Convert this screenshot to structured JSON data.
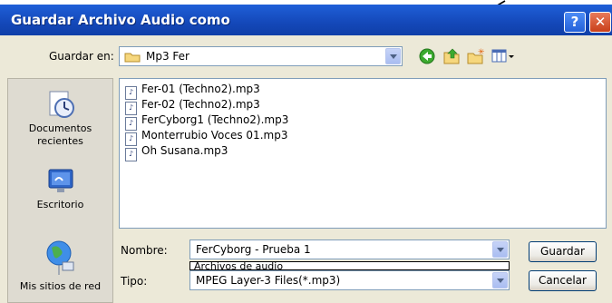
{
  "window": {
    "title": "Guardar Archivo Audio como",
    "help_label": "?",
    "close_label": "✕"
  },
  "location": {
    "label": "Guardar en:",
    "value": "Mp3 Fer"
  },
  "places": [
    {
      "label": "Documentos recientes",
      "icon": "recent-documents-icon"
    },
    {
      "label": "Escritorio",
      "icon": "desktop-icon"
    },
    {
      "label": "Mis sitios de red",
      "icon": "network-places-icon"
    }
  ],
  "files": [
    "Fer-01 (Techno2).mp3",
    "Fer-02 (Techno2).mp3",
    "FerCyborg1 (Techno2).mp3",
    "Monterrubio Voces 01.mp3",
    "Oh Susana.mp3"
  ],
  "filename": {
    "label": "Nombre:",
    "value": "FerCyborg - Prueba 1"
  },
  "filetype": {
    "label": "Tipo:",
    "value": "MPEG Layer-3 Files(*.mp3)",
    "dropdown_peek": "Archivos de audio"
  },
  "buttons": {
    "save": "Guardar",
    "cancel": "Cancelar"
  },
  "colors": {
    "titlebar": "#1448b9",
    "dialog_bg": "#ece9d8"
  }
}
